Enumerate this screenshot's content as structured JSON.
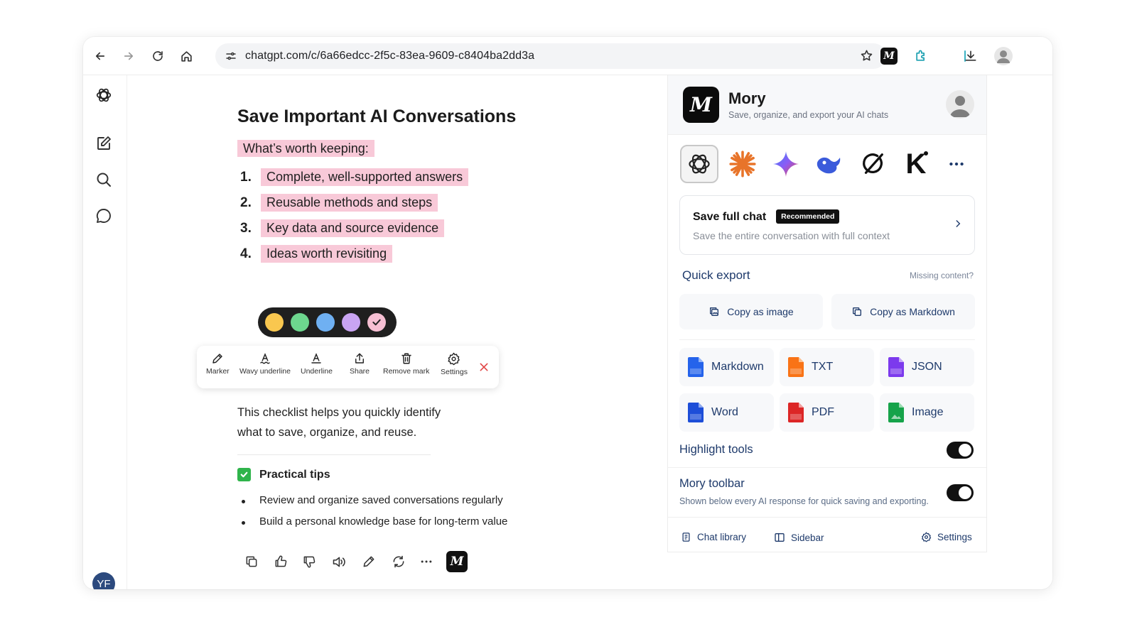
{
  "browser": {
    "url": "chatgpt.com/c/6a66edcc-2f5c-83ea-9609-c8404ba2dd3a",
    "extension_logo_letter": "M"
  },
  "sidebar": {
    "user_initials": "YF"
  },
  "chat": {
    "title": "Save Important AI Conversations",
    "worth_keeping": "What’s worth keeping:",
    "list": [
      {
        "num": "1.",
        "text": "Complete, well-supported answers"
      },
      {
        "num": "2.",
        "text": "Reusable methods and steps"
      },
      {
        "num": "3.",
        "text": "Key data and source evidence"
      },
      {
        "num": "4.",
        "text": "Ideas worth revisiting"
      }
    ],
    "highlight_colors": [
      "#f9c74f",
      "#6dd68e",
      "#6fb0f2",
      "#c9a4f2",
      "#f6bfd3"
    ],
    "toolbar": {
      "marker": "Marker",
      "wavy": "Wavy underline",
      "underline": "Underline",
      "share": "Share",
      "remove": "Remove mark",
      "settings": "Settings"
    },
    "paragraph": "This checklist helps you quickly identify what to save, organize, and reuse.",
    "tips_title": "Practical tips",
    "tips": [
      "Review and organize saved conversations regularly",
      "Build a personal knowledge base for long-term value"
    ],
    "mory_button_letter": "M"
  },
  "panel": {
    "logo_letter": "M",
    "name": "Mory",
    "subtitle": "Save, organize, and export your AI chats",
    "save_full": {
      "title": "Save full chat",
      "badge": "Recommended",
      "subtitle": "Save the entire conversation with full context"
    },
    "quick_export": "Quick export",
    "missing": "Missing content?",
    "copy_image": "Copy as image",
    "copy_markdown": "Copy as Markdown",
    "formats": [
      {
        "label": "Markdown",
        "color": "#2563eb",
        "tag": "MD"
      },
      {
        "label": "TXT",
        "color": "#f97316",
        "tag": "TXT"
      },
      {
        "label": "JSON",
        "color": "#7c3aed",
        "tag": "{}"
      },
      {
        "label": "Word",
        "color": "#1d4ed8",
        "tag": "W"
      },
      {
        "label": "PDF",
        "color": "#dc2626",
        "tag": "PDF"
      },
      {
        "label": "Image",
        "color": "#16a34a",
        "tag": "IMG"
      }
    ],
    "highlight_tools": "Highlight tools",
    "highlight_tools_on": true,
    "mory_toolbar": "Mory toolbar",
    "mory_toolbar_on": true,
    "mory_toolbar_sub": "Shown below every AI response for quick saving and exporting.",
    "footer": {
      "library": "Chat library",
      "sidebar": "Sidebar",
      "settings": "Settings"
    },
    "ai_letter_k": "K"
  }
}
